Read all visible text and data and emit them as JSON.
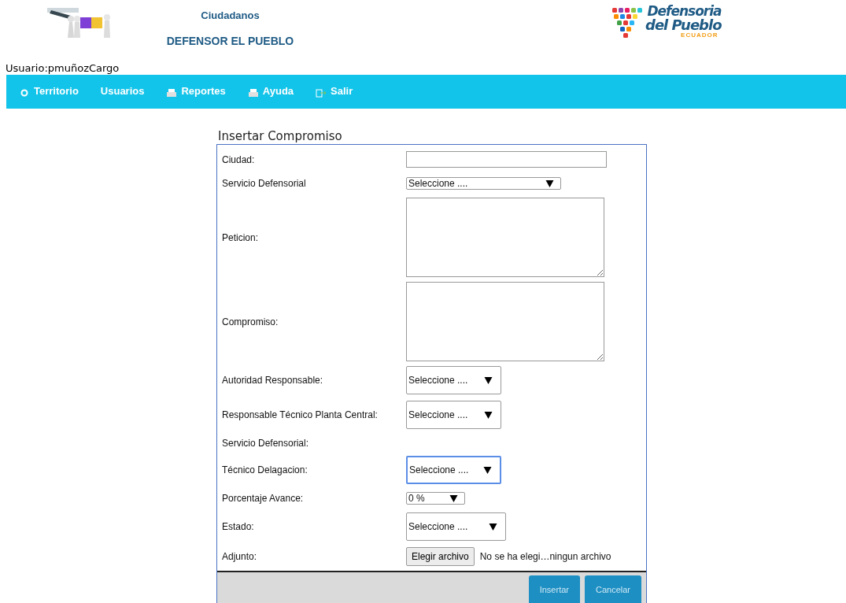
{
  "header": {
    "title": "Ciudadanos",
    "subtitle": "DEFENSOR EL PUEBLO",
    "logo": {
      "line_1": "Defensoria",
      "line_2": "del Pueblo",
      "country": "ECUADOR"
    }
  },
  "user": "Usuario:pmuñozCargo",
  "menu": [
    {
      "label": "Territorio"
    },
    {
      "label": "Usuarios"
    },
    {
      "label": "Reportes"
    },
    {
      "label": "Ayuda"
    },
    {
      "label": "Salir"
    }
  ],
  "form": {
    "title": "Insertar Compromiso",
    "rows": [
      {
        "kind": "text",
        "label": "Ciudad:"
      },
      {
        "kind": "select",
        "label": "Servicio Defensorial",
        "value": "Seleccione ....",
        "boxed": false,
        "focused": false
      },
      {
        "kind": "textarea",
        "label": "Peticion:"
      },
      {
        "kind": "textarea",
        "label": "Compromiso:"
      },
      {
        "kind": "select",
        "label": "Autoridad Responsable:",
        "value": "Seleccione ....",
        "boxed": true,
        "focused": false
      },
      {
        "kind": "select",
        "label": "Responsable Técnico Planta Central:",
        "value": "Seleccione ....",
        "boxed": true,
        "focused": false
      },
      {
        "kind": "label",
        "label": "Servicio Defensorial:"
      },
      {
        "kind": "select",
        "label": "Técnico Delagacion:",
        "value": "Seleccione ....",
        "boxed": true,
        "focused": true
      },
      {
        "kind": "select",
        "label": "Porcentaje Avance:",
        "value": "0 %",
        "boxed": false,
        "focused": false
      },
      {
        "kind": "select",
        "label": "Estado:",
        "value": "Seleccione ....",
        "boxed": true,
        "focused": false
      },
      {
        "kind": "file",
        "label": "Adjunto:",
        "button": "Elegir archivo",
        "status": "No se ha elegi…ningun archivo"
      }
    ],
    "buttons": [
      "Insertar",
      "Cancelar"
    ]
  }
}
